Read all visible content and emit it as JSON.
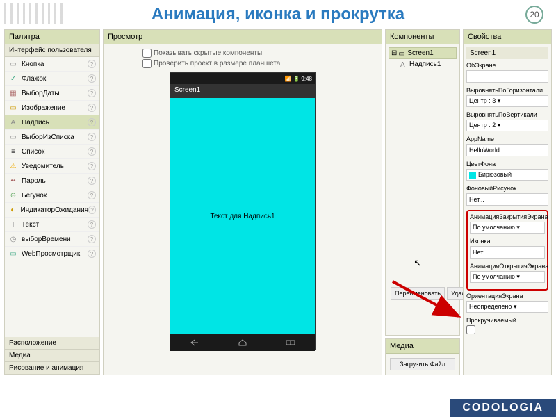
{
  "title": "Анимация, иконка и прокрутка",
  "page_number": "20",
  "palette": {
    "header": "Палитра",
    "section": "Интерфейс пользователя",
    "items": [
      {
        "label": "Кнопка",
        "icon": "▭",
        "color": "#888"
      },
      {
        "label": "Флажок",
        "icon": "✓",
        "color": "#4a8"
      },
      {
        "label": "ВыборДаты",
        "icon": "▦",
        "color": "#a66"
      },
      {
        "label": "Изображение",
        "icon": "▭",
        "color": "#c90"
      },
      {
        "label": "Надпись",
        "icon": "A",
        "color": "#888",
        "selected": true
      },
      {
        "label": "ВыборИзСписка",
        "icon": "▭",
        "color": "#888"
      },
      {
        "label": "Список",
        "icon": "≡",
        "color": "#333"
      },
      {
        "label": "Уведомитель",
        "icon": "⚠",
        "color": "#ea0"
      },
      {
        "label": "Пароль",
        "icon": "••",
        "color": "#a66"
      },
      {
        "label": "Бегунок",
        "icon": "⊖",
        "color": "#6a6"
      },
      {
        "label": "ИндикаторОжидания",
        "icon": "◐",
        "color": "#c90"
      },
      {
        "label": "Текст",
        "icon": "I",
        "color": "#888"
      },
      {
        "label": "выборВремени",
        "icon": "◷",
        "color": "#888"
      },
      {
        "label": "WebПросмотрщик",
        "icon": "▭",
        "color": "#4a8"
      }
    ],
    "sections": [
      "Расположение",
      "Медиа",
      "Рисование и анимация"
    ]
  },
  "viewer": {
    "header": "Просмотр",
    "check1": "Показывать скрытые компоненты",
    "check2": "Проверить проект в размере планшета",
    "phone_time": "9:48",
    "phone_title": "Screen1",
    "screen_text": "Текст для Надпись1"
  },
  "components": {
    "header": "Компоненты",
    "root": "Screen1",
    "child": "Надпись1",
    "btn_rename": "Переименовать",
    "btn_delete": "Удалить",
    "media_header": "Медиа",
    "upload_btn": "Загрузить Файл"
  },
  "properties": {
    "header": "Свойства",
    "title": "Screen1",
    "items": [
      {
        "label": "ОбЭкране",
        "type": "input",
        "value": ""
      },
      {
        "label": "ВыровнятьПоГоризонтали",
        "type": "select",
        "value": "Центр : 3"
      },
      {
        "label": "ВыровнятьПоВертикали",
        "type": "select",
        "value": "Центр : 2"
      },
      {
        "label": "AppName",
        "type": "input",
        "value": "HelloWorld"
      },
      {
        "label": "ЦветФона",
        "type": "color",
        "value": "Бирюзовый"
      },
      {
        "label": "ФоновыйРисунок",
        "type": "input",
        "value": "Нет..."
      }
    ],
    "highlighted": [
      {
        "label": "АнимацияЗакрытияЭкрана",
        "type": "select",
        "value": "По умолчанию"
      },
      {
        "label": "Иконка",
        "type": "input",
        "value": "Нет..."
      },
      {
        "label": "АнимацияОткрытияЭкрана",
        "type": "select",
        "value": "По умолчанию"
      }
    ],
    "after": [
      {
        "label": "ОриентацияЭкрана",
        "type": "select",
        "value": "Неопределено"
      },
      {
        "label": "Прокручиваемый",
        "type": "checkbox",
        "value": false
      }
    ]
  },
  "footer": "CODOLOGIA"
}
